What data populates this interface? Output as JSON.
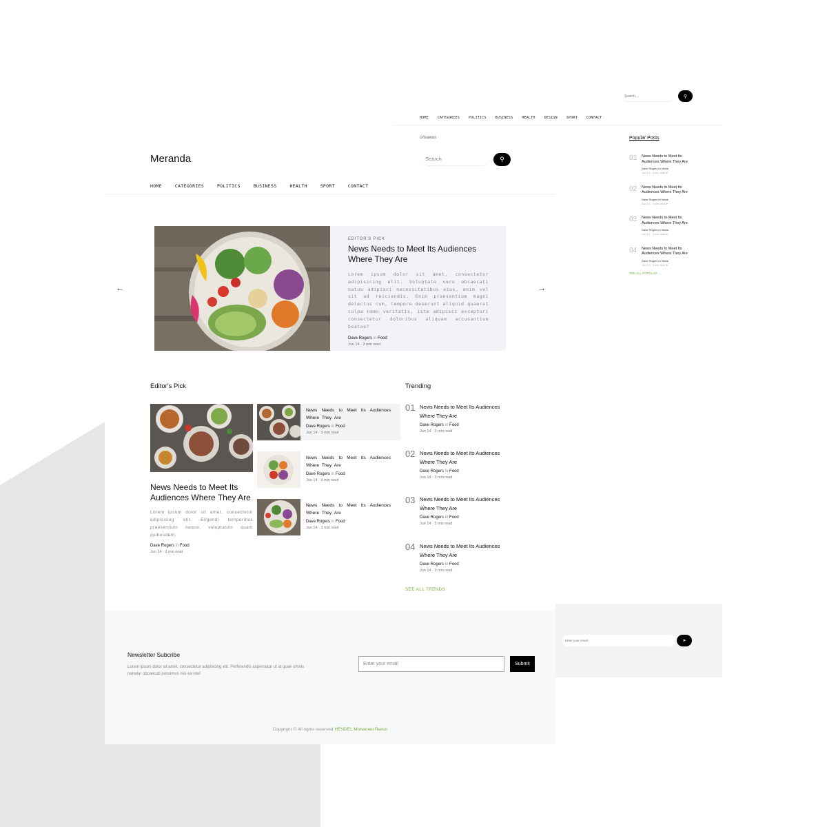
{
  "mini_header": {
    "search_placeholder": "Search...",
    "nav": [
      "HOME",
      "CATEGORIES",
      "POLITICS",
      "BUSINESS",
      "HEALTH",
      "DESIGN",
      "SPORT",
      "CONTACT"
    ],
    "sub_label": "CATEGORIES"
  },
  "popular": {
    "title": "Popular Posts",
    "items": [
      {
        "num": "01",
        "title": "News Needs to Meet Its Audiences Where They Are",
        "author": "Dave Rogers",
        "in": "in",
        "category": "News",
        "meta": "Jun 14 · 3 min read ♥"
      },
      {
        "num": "02",
        "title": "News Needs to Meet Its Audiences Where They Are",
        "author": "Dave Rogers",
        "in": "in",
        "category": "News",
        "meta": "Jun 14 · 3 min read ♥"
      },
      {
        "num": "03",
        "title": "News Needs to Meet Its Audiences Where They Are",
        "author": "Dave Rogers",
        "in": "in",
        "category": "News",
        "meta": "Jun 14 · 3 min read ♥"
      },
      {
        "num": "04",
        "title": "News Needs to Meet Its Audiences Where They Are",
        "author": "Dave Rogers",
        "in": "in",
        "category": "News",
        "meta": "Jun 14 · 3 min read ♥"
      }
    ],
    "see_all": "SEE ALL POPULAR →"
  },
  "header": {
    "logo": "Meranda",
    "search_placeholder": "Search",
    "nav": [
      "HOME",
      "CATEGORIES",
      "POLITICS",
      "BUSINESS",
      "HEALTH",
      "SPORT",
      "CONTACT"
    ]
  },
  "hero": {
    "kicker": "EDITOR'S PICK",
    "title": "News Needs to Meet Its Audiences Where They Are",
    "body": "Lorem ipsum dolor sit amet, consectetur adipisicing elit. Voluptate vero obcaecati natus adipisci necessitatibus eius, enim vel sit ad reiciendis. Enim praesentium magni delectus cum, tempore deserunt aliquid quaerat culpa nemo veritatis, iste adipisci excepturi consectetur doloribus aliquam accusantium beatae?",
    "author": "Dave Rogers",
    "in": "in",
    "category": "Food",
    "meta": "Jun 14 · 3 min read",
    "prev_icon": "←",
    "next_icon": "→"
  },
  "editors_pick": {
    "title": "Editor's Pick",
    "main": {
      "title": "News Needs to Meet Its Audiences Where They Are",
      "body": "Lorem ipsum dolor sit amet, consectetur adipisicing elit. Eligendi temporibus praesentium neque, voluptatum quam quibusdam.",
      "author": "Dave Rogers",
      "in": "in",
      "category": "Food",
      "meta": "Jun 14 · 3 min read"
    },
    "items": [
      {
        "title": "News Needs to Meet Its Audiences Where They Are",
        "author": "Dave Rogers",
        "in": "in",
        "category": "Food",
        "meta": "Jun 14 · 3 min read"
      },
      {
        "title": "News Needs to Meet Its Audiences Where They Are",
        "author": "Dave Rogers",
        "in": "in",
        "category": "Food",
        "meta": "Jun 14 · 3 min read"
      },
      {
        "title": "News Needs to Meet Its Audiences Where They Are",
        "author": "Dave Rogers",
        "in": "in",
        "category": "Food",
        "meta": "Jun 14 · 3 min read"
      }
    ]
  },
  "trending": {
    "title": "Trending",
    "items": [
      {
        "num": "01",
        "title": "News Needs to Meet Its Audiences Where They Are",
        "author": "Dave Rogers",
        "in": "in",
        "category": "Food",
        "meta": "Jun 14 · 3 min read"
      },
      {
        "num": "02",
        "title": "News Needs to Meet Its Audiences Where They Are",
        "author": "Dave Rogers",
        "in": "in",
        "category": "Food",
        "meta": "Jun 14 · 3 min read"
      },
      {
        "num": "03",
        "title": "News Needs to Meet Its Audiences Where They Are",
        "author": "Dave Rogers",
        "in": "in",
        "category": "Food",
        "meta": "Jun 14 · 3 min read"
      },
      {
        "num": "04",
        "title": "News Needs to Meet Its Audiences Where They Are",
        "author": "Dave Rogers",
        "in": "in",
        "category": "Food",
        "meta": "Jun 14 · 3 min read"
      }
    ],
    "see_all": "SEE ALL TRENDS"
  },
  "newsletter": {
    "title": "Newsletter Subcribe",
    "text": "Lorem ipsum dolor sit amet, consectetur adipisicing elit. Perferendis aspernatur ut at quae omnis pariatur obcaecati possimus nisi ea iste!",
    "placeholder": "Enter your email",
    "submit": "Submit",
    "mini_placeholder": "Enter your email"
  },
  "footer": {
    "copyright": "Copyright © All rights reserved",
    "author": "HENDEL Mohamed Ramzi"
  },
  "colors": {
    "accent": "#7cb342",
    "panel": "#f1f3f6",
    "footer_bg": "#f7f8f9"
  }
}
